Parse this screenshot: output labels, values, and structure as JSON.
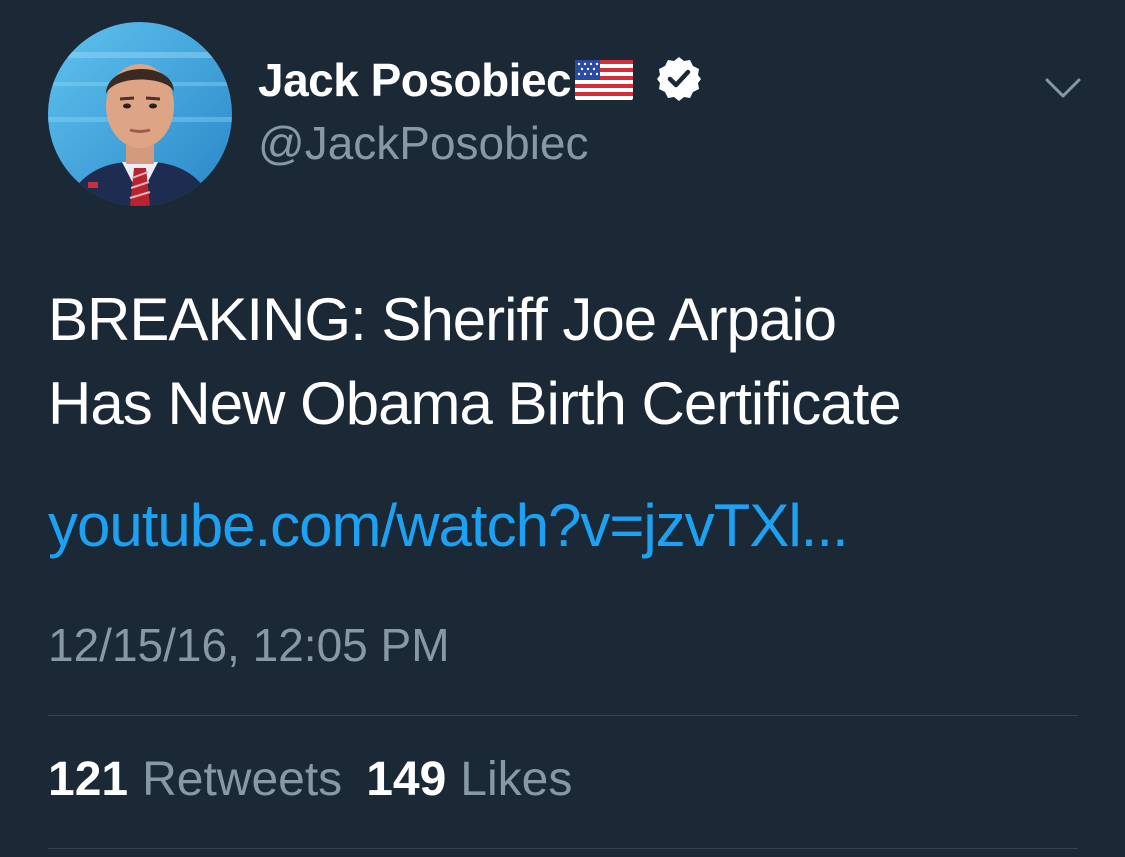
{
  "tweet": {
    "display_name": "Jack Posobiec",
    "handle": "@JackPosobiec",
    "verified": true,
    "text_lines": [
      "BREAKING: Sheriff Joe Arpaio",
      "Has New Obama Birth Certificate"
    ],
    "link": "youtube.com/watch?v=jzvTXl...",
    "timestamp": "12/15/16, 12:05 PM",
    "retweets_count": "121",
    "retweets_label": "Retweets",
    "likes_count": "149",
    "likes_label": "Likes"
  },
  "icons": {
    "flag": "us-flag-icon",
    "verified": "verified-badge-icon",
    "menu": "chevron-down-icon"
  },
  "colors": {
    "background": "#1b2836",
    "text": "#ffffff",
    "secondary": "#8899a6",
    "link": "#1da1f2",
    "divider": "#38444d"
  }
}
